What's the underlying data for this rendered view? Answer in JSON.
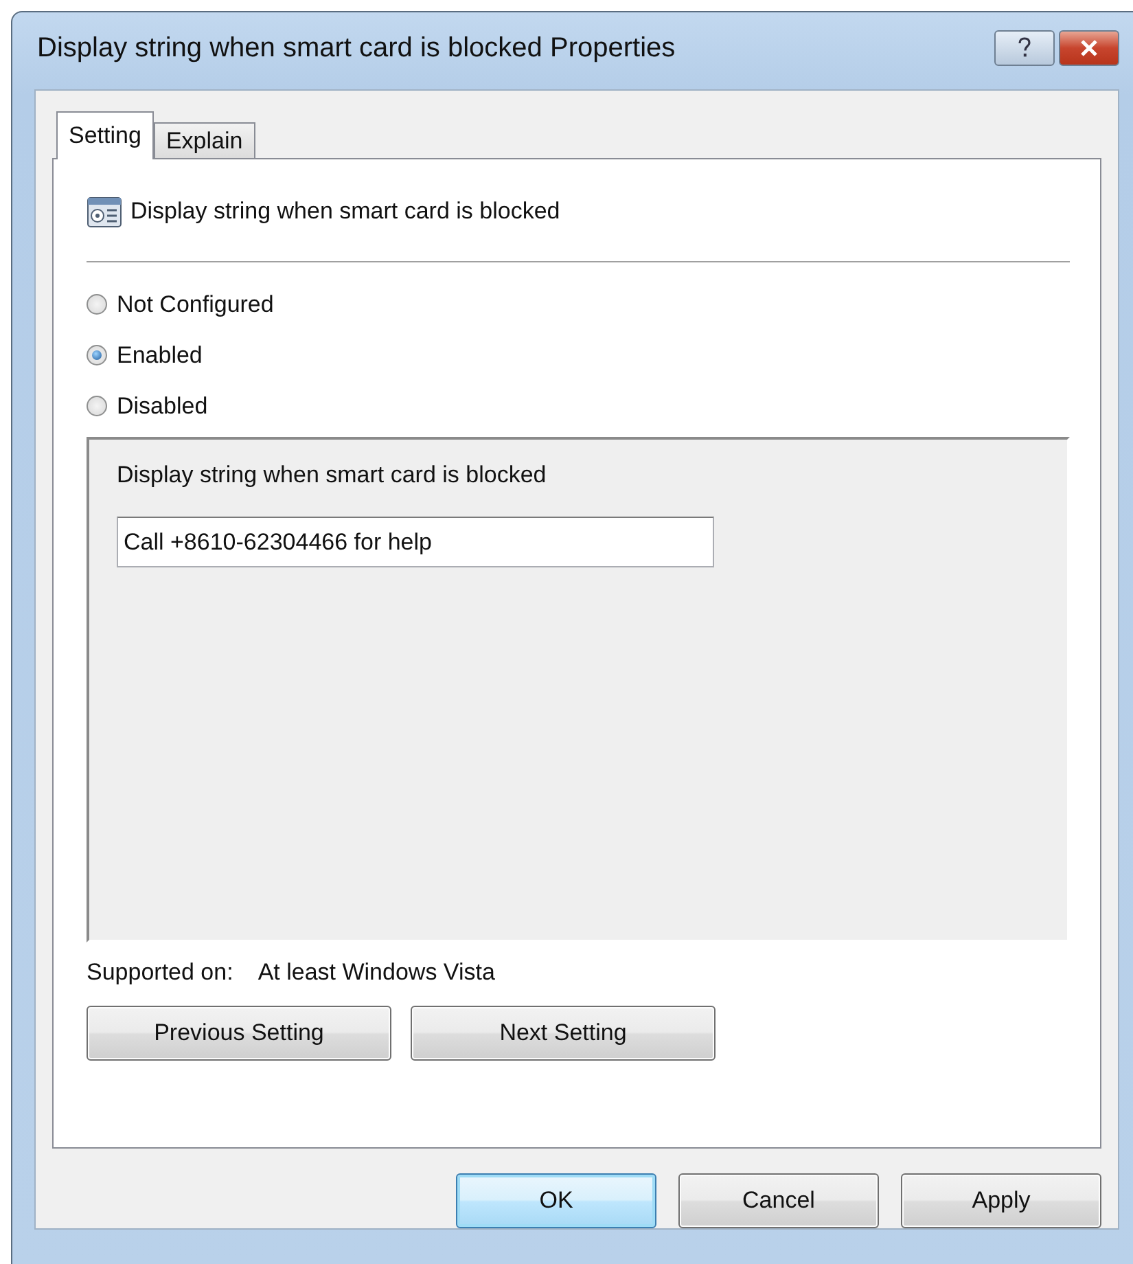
{
  "window": {
    "title": "Display string when smart card is blocked Properties"
  },
  "tabs": [
    {
      "label": "Setting",
      "selected": true
    },
    {
      "label": "Explain",
      "selected": false
    }
  ],
  "policy": {
    "name": "Display string when smart card is blocked"
  },
  "options": [
    {
      "label": "Not Configured",
      "selected": false
    },
    {
      "label": "Enabled",
      "selected": true
    },
    {
      "label": "Disabled",
      "selected": false
    }
  ],
  "option_panel": {
    "label": "Display string when smart card is blocked",
    "value": "Call +8610-62304466 for help"
  },
  "supported": {
    "label": "Supported on:",
    "value": "At least Windows Vista"
  },
  "nav_buttons": [
    "Previous Setting",
    "Next Setting"
  ],
  "buttons": [
    {
      "label": "OK",
      "default": true
    },
    {
      "label": "Cancel",
      "default": false
    },
    {
      "label": "Apply",
      "default": false
    }
  ]
}
